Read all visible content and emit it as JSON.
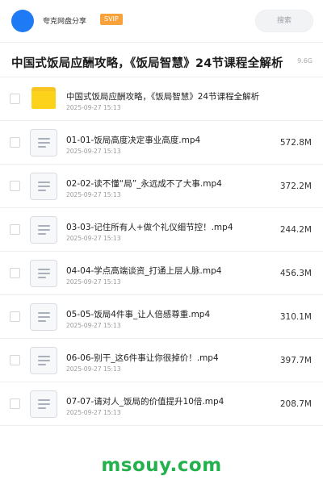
{
  "header": {
    "share_name": "夸克网盘分享",
    "vip_badge": "SVIP",
    "search_placeholder": "搜索",
    "accent_color": "#1e7bf5",
    "vip_color": "#f7a23b"
  },
  "title_bar": {
    "title": "中国式饭局应酬攻略，《饭局智慧》24节课程全解析",
    "total_size": "9.6G"
  },
  "items": [
    {
      "type": "folder",
      "icon": "folder-icon",
      "name": "中国式饭局应酬攻略，《饭局智慧》24节课程全解析",
      "date": "2025-09-27 15:13",
      "size": ""
    },
    {
      "type": "file",
      "icon": "file-document-icon",
      "name": "01-01-饭局高度决定事业高度.mp4",
      "date": "2025-09-27 15:13",
      "size": "572.8M"
    },
    {
      "type": "file",
      "icon": "file-document-icon",
      "name": "02-02-读不懂“局”_永远成不了大事.mp4",
      "date": "2025-09-27 15:13",
      "size": "372.2M"
    },
    {
      "type": "file",
      "icon": "file-document-icon",
      "name": "03-03-记住所有人+做个礼仪细节控！.mp4",
      "date": "2025-09-27 15:13",
      "size": "244.2M"
    },
    {
      "type": "file",
      "icon": "file-document-icon",
      "name": "04-04-学点高端谈资_打通上层人脉.mp4",
      "date": "2025-09-27 15:13",
      "size": "456.3M"
    },
    {
      "type": "file",
      "icon": "file-document-icon",
      "name": "05-05-饭局4件事_让人倍感尊重.mp4",
      "date": "2025-09-27 15:13",
      "size": "310.1M"
    },
    {
      "type": "file",
      "icon": "file-document-icon",
      "name": "06-06-别干_这6件事让你很掉价！.mp4",
      "date": "2025-09-27 15:13",
      "size": "397.7M"
    },
    {
      "type": "file",
      "icon": "file-document-icon",
      "name": "07-07-请对人_饭局的价值提升10倍.mp4",
      "date": "2025-09-27 15:13",
      "size": "208.7M"
    }
  ],
  "watermark": "msouy.com"
}
